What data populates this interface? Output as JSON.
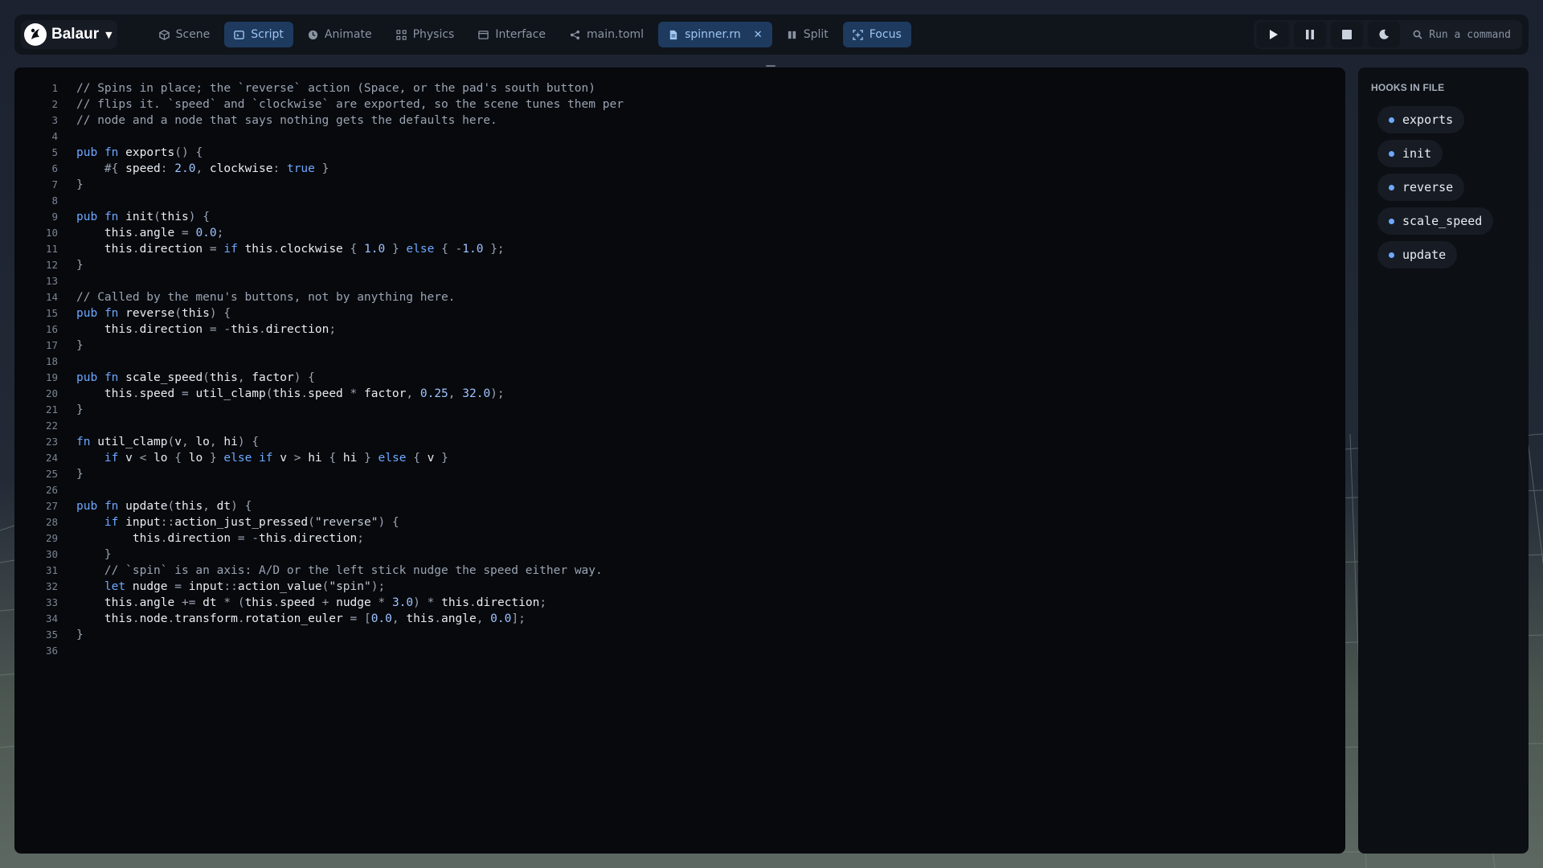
{
  "brand": {
    "name": "Balaur"
  },
  "tabs": [
    {
      "label": "Scene",
      "icon": "cube-icon",
      "active": false
    },
    {
      "label": "Script",
      "icon": "code-icon",
      "active": true
    },
    {
      "label": "Animate",
      "icon": "clock-icon",
      "active": false
    },
    {
      "label": "Physics",
      "icon": "nodes-icon",
      "active": false
    },
    {
      "label": "Interface",
      "icon": "window-icon",
      "active": false
    },
    {
      "label": "main.toml",
      "icon": "share-icon",
      "active": false
    },
    {
      "label": "spinner.rn",
      "icon": "file-icon",
      "active": true,
      "closable": true
    },
    {
      "label": "Split",
      "icon": "columns-icon",
      "active": false
    },
    {
      "label": "Focus",
      "icon": "focus-icon",
      "active": true
    }
  ],
  "toolbar": {
    "play": "play-icon",
    "pause": "pause-icon",
    "stop": "stop-icon",
    "theme": "moon-icon",
    "command_placeholder": "Run a command"
  },
  "code_lines": [
    "// Spins in place; the `reverse` action (Space, or the pad's south button)",
    "// flips it. `speed` and `clockwise` are exported, so the scene tunes them per",
    "// node and a node that says nothing gets the defaults here.",
    "",
    "pub fn exports() {",
    "    #{ speed: 2.0, clockwise: true }",
    "}",
    "",
    "pub fn init(this) {",
    "    this.angle = 0.0;",
    "    this.direction = if this.clockwise { 1.0 } else { -1.0 };",
    "}",
    "",
    "// Called by the menu's buttons, not by anything here.",
    "pub fn reverse(this) {",
    "    this.direction = -this.direction;",
    "}",
    "",
    "pub fn scale_speed(this, factor) {",
    "    this.speed = util_clamp(this.speed * factor, 0.25, 32.0);",
    "}",
    "",
    "fn util_clamp(v, lo, hi) {",
    "    if v < lo { lo } else if v > hi { hi } else { v }",
    "}",
    "",
    "pub fn update(this, dt) {",
    "    if input::action_just_pressed(\"reverse\") {",
    "        this.direction = -this.direction;",
    "    }",
    "    // `spin` is an axis: A/D or the left stick nudge the speed either way.",
    "    let nudge = input::action_value(\"spin\");",
    "    this.angle += dt * (this.speed + nudge * 3.0) * this.direction;",
    "    this.node.transform.rotation_euler = [0.0, this.angle, 0.0];",
    "}",
    ""
  ],
  "hooks_panel": {
    "title": "HOOKS IN FILE",
    "items": [
      "exports",
      "init",
      "reverse",
      "scale_speed",
      "update"
    ]
  },
  "colors": {
    "accent": "#6ea8ff",
    "active_tab_bg": "#1e3a5f",
    "editor_bg": "#07090d"
  }
}
